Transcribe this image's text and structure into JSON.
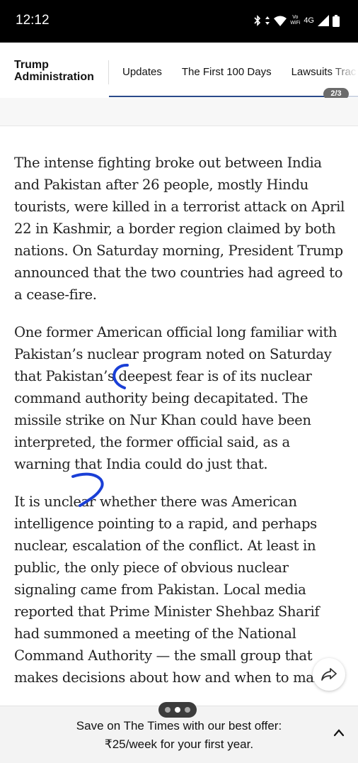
{
  "status_bar": {
    "time": "12:12",
    "network_top": "Vo",
    "network_bottom": "WiFi",
    "network_type": "4G"
  },
  "header": {
    "section_title_line1": "Trump",
    "section_title_line2": "Administration",
    "nav_items": [
      "Updates",
      "The First 100 Days",
      "Lawsuits Trac"
    ],
    "page_indicator": "2/3",
    "accent_color": "#2a4a8a"
  },
  "article": {
    "paragraphs": [
      "The intense fighting broke out between India and Pakistan after 26 people, mostly Hindu tourists, were killed in a terrorist attack on April 22 in Kashmir, a border region claimed by both nations. On Saturday morning, President Trump announced that the two countries had agreed to a cease-fire.",
      "One former American official long familiar with Pakistan’s nuclear program noted on Saturday that Pakistan’s deepest fear is of its nuclear command authority being decapitated. The missile strike on Nur Khan could have been interpreted, the former official said, as a warning that India could do just that.",
      "It is unclear whether there was American intelligence pointing to a rapid, and perhaps nuclear, escalation of the conflict. At least in public, the only piece of obvious nuclear signaling came from Pakistan. Local media reported that Prime Minister Shehbaz Sharif had summoned a meeting of the National Command Authority — the small group that makes decisions about how and when to make"
    ],
    "annotation_color": "#1a3fd6"
  },
  "offer": {
    "line1": "Save on The Times with our best offer:",
    "line2": "₹25/week for your first year."
  },
  "icons": {
    "share": "share-arrow-icon",
    "expand": "chevron-up-icon"
  }
}
